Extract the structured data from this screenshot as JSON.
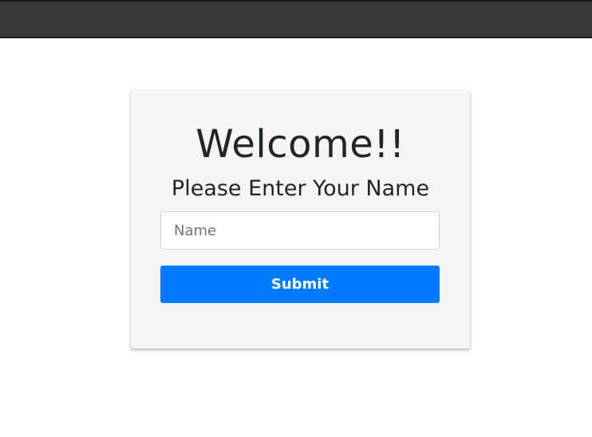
{
  "form": {
    "title": "Welcome!!",
    "subtitle": "Please Enter Your Name",
    "name_placeholder": "Name",
    "name_value": "",
    "submit_label": "Submit"
  },
  "colors": {
    "topbar": "#3a3a3a",
    "card_background": "#f5f5f5",
    "submit_button": "#007bff",
    "text": "#212529"
  }
}
